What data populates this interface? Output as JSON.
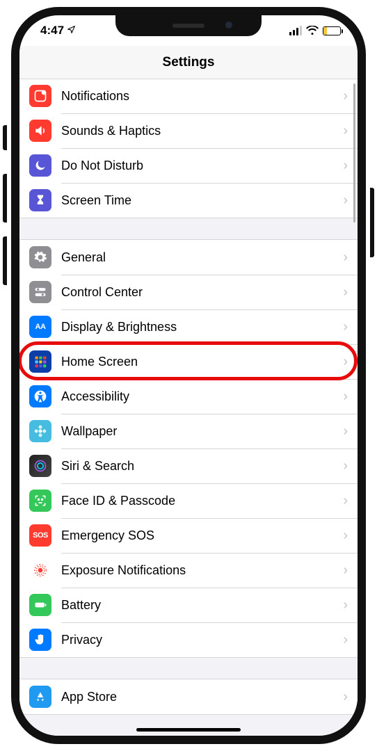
{
  "statusbar": {
    "time": "4:47"
  },
  "header": {
    "title": "Settings"
  },
  "groups": [
    {
      "rows": [
        {
          "name": "notifications",
          "label": "Notifications",
          "icon": "notifications-icon",
          "bg": "bg-red"
        },
        {
          "name": "sounds-haptics",
          "label": "Sounds & Haptics",
          "icon": "speaker-icon",
          "bg": "bg-red2"
        },
        {
          "name": "do-not-disturb",
          "label": "Do Not Disturb",
          "icon": "moon-icon",
          "bg": "bg-purple"
        },
        {
          "name": "screen-time",
          "label": "Screen Time",
          "icon": "hourglass-icon",
          "bg": "bg-purple"
        }
      ]
    },
    {
      "rows": [
        {
          "name": "general",
          "label": "General",
          "icon": "gear-icon",
          "bg": "bg-gray"
        },
        {
          "name": "control-center",
          "label": "Control Center",
          "icon": "toggles-icon",
          "bg": "bg-gray"
        },
        {
          "name": "display-brightness",
          "label": "Display & Brightness",
          "icon": "text-size-icon",
          "bg": "bg-blue"
        },
        {
          "name": "home-screen",
          "label": "Home Screen",
          "icon": "app-grid-icon",
          "bg": "bg-darkblue",
          "highlight": true
        },
        {
          "name": "accessibility",
          "label": "Accessibility",
          "icon": "accessibility-icon",
          "bg": "bg-blue"
        },
        {
          "name": "wallpaper",
          "label": "Wallpaper",
          "icon": "flower-icon",
          "bg": "bg-cyan"
        },
        {
          "name": "siri-search",
          "label": "Siri & Search",
          "icon": "siri-icon",
          "bg": "bg-multicolor"
        },
        {
          "name": "faceid-passcode",
          "label": "Face ID & Passcode",
          "icon": "faceid-icon",
          "bg": "bg-green"
        },
        {
          "name": "emergency-sos",
          "label": "Emergency SOS",
          "icon": "sos-icon",
          "bg": "bg-redsos"
        },
        {
          "name": "exposure-notifications",
          "label": "Exposure Notifications",
          "icon": "exposure-icon",
          "bg": "bg-white"
        },
        {
          "name": "battery",
          "label": "Battery",
          "icon": "battery-icon",
          "bg": "bg-green"
        },
        {
          "name": "privacy",
          "label": "Privacy",
          "icon": "hand-icon",
          "bg": "bg-blue"
        }
      ]
    },
    {
      "rows": [
        {
          "name": "app-store",
          "label": "App Store",
          "icon": "app-store-icon",
          "bg": "bg-skyblue"
        }
      ]
    }
  ]
}
